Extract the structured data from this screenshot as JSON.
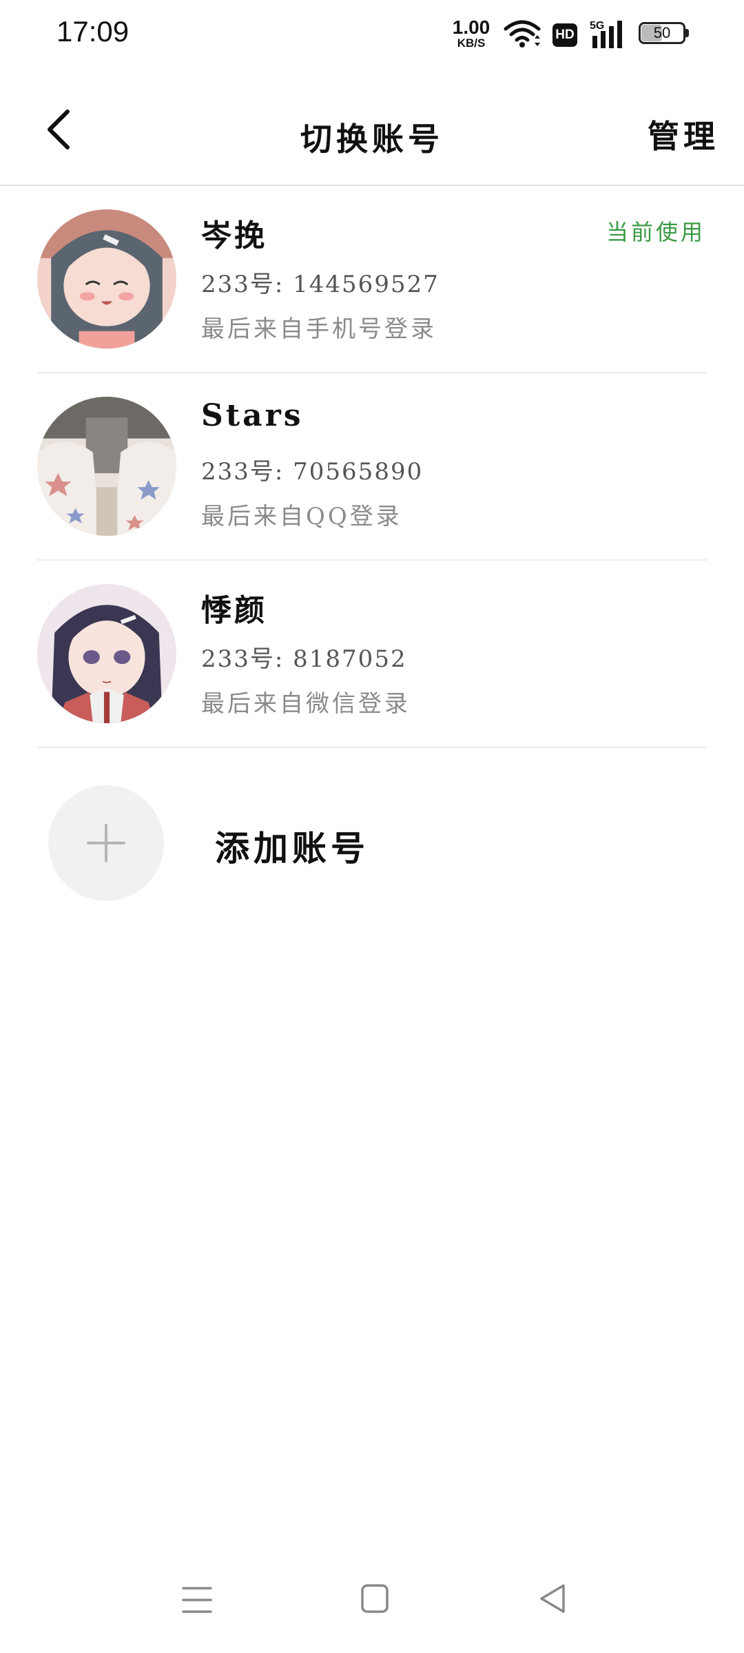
{
  "status_bar": {
    "time": "17:09",
    "net_speed_value": "1.00",
    "net_speed_unit": "KB/S",
    "hd_label": "HD",
    "network_label": "5G",
    "battery_level": "50"
  },
  "header": {
    "title": "切换账号",
    "manage_label": "管理"
  },
  "accounts": [
    {
      "name": "岑挽",
      "uid": "233号: 144569527",
      "login": "最后来自手机号登录",
      "badge": "当前使用"
    },
    {
      "name": "Stars",
      "uid": "233号: 70565890",
      "login": "最后来自QQ登录"
    },
    {
      "name": "悸颜",
      "uid": "233号: 8187052",
      "login": "最后来自微信登录"
    }
  ],
  "add_account": {
    "label": "添加账号"
  },
  "colors": {
    "accent_green": "#3a9a44",
    "divider": "#ececec",
    "secondary_text": "#8a8a8a"
  },
  "icons": [
    "back-icon",
    "wifi-icon",
    "signal-icon",
    "battery-icon",
    "plus-icon",
    "menu-icon",
    "home-icon",
    "back-triangle-icon"
  ]
}
